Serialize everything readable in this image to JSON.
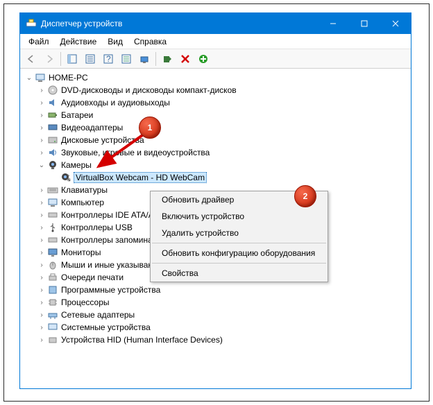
{
  "window": {
    "title": "Диспетчер устройств"
  },
  "menu": {
    "file": "Файл",
    "action": "Действие",
    "view": "Вид",
    "help": "Справка"
  },
  "tree": {
    "root": "HOME-PC",
    "dvd": "DVD-дисководы и дисководы компакт-дисков",
    "audio": "Аудиовходы и аудиовыходы",
    "batt": "Батареи",
    "video": "Видеоадаптеры",
    "disk": "Дисковые устройства",
    "sound": "Звуковые, игровые и видеоустройства",
    "cam": "Камеры",
    "cam_child": "VirtualBox Webcam - HD WebCam",
    "keyboard": "Клавиатуры",
    "computer": "Компьютер",
    "ide": "Контроллеры IDE ATA/ATAPI",
    "usb": "Контроллеры USB",
    "storage": "Контроллеры запоминающ",
    "monitors": "Мониторы",
    "mice": "Мыши и иные указывающи",
    "print": "Очереди печати",
    "soft": "Программные устройства",
    "cpu": "Процессоры",
    "net": "Сетевые адаптеры",
    "sys": "Системные устройства",
    "hid": "Устройства HID (Human Interface Devices)"
  },
  "ctx": {
    "update": "Обновить драйвер",
    "enable": "Включить устройство",
    "remove": "Удалить устройство",
    "scan": "Обновить конфигурацию оборудования",
    "props": "Свойства"
  },
  "ann": {
    "one": "1",
    "two": "2"
  }
}
